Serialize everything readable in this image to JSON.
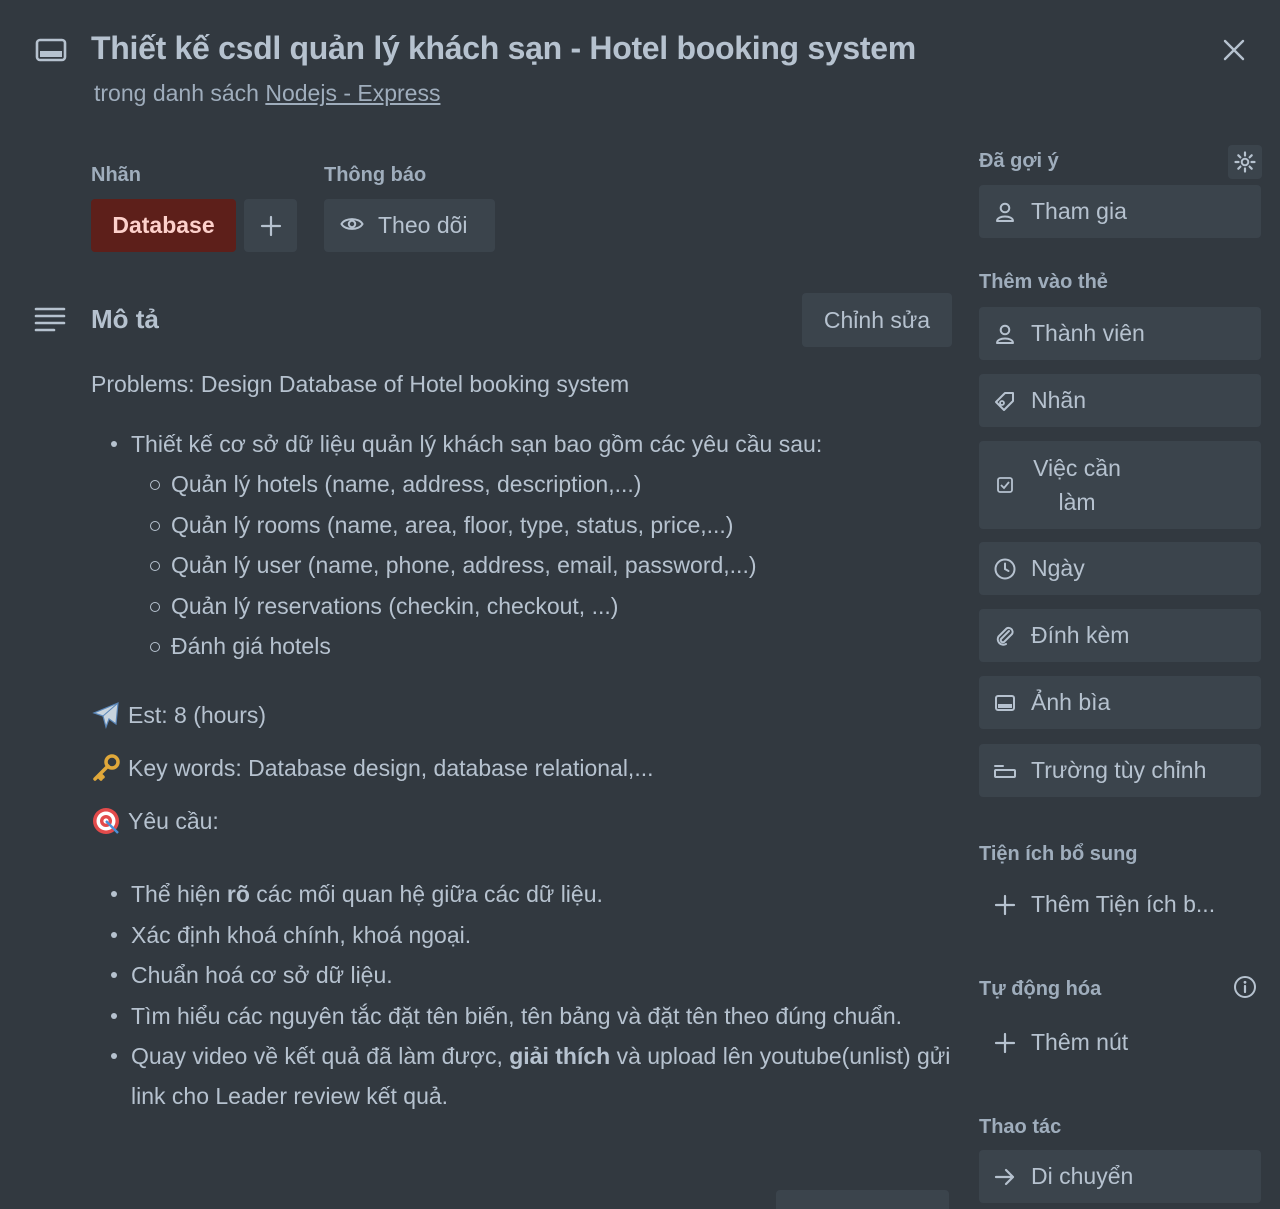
{
  "header": {
    "title": "Thiết kế csdl quản lý khách sạn - Hotel booking system",
    "list_prefix": "trong danh sách",
    "list_name": "Nodejs - Express"
  },
  "labels_section": {
    "heading": "Nhãn",
    "chip": "Database",
    "chip_color": "#5d1f1a"
  },
  "notify_section": {
    "heading": "Thông báo",
    "watch_label": "Theo dõi"
  },
  "description": {
    "heading": "Mô tả",
    "edit_label": "Chỉnh sửa",
    "problem": "Problems: Design Database of Hotel booking system",
    "main_item": "Thiết kế cơ sở dữ liệu quản lý khách sạn bao gồm các yêu cầu sau:",
    "sub_items": [
      "Quản lý hotels (name, address, description,...)",
      "Quản lý rooms (name, area, floor, type, status, price,...)",
      "Quản lý user (name, phone, address, email, password,...)",
      "Quản lý reservations (checkin, checkout, ...)",
      "Đánh giá hotels"
    ],
    "est": "Est: 8 (hours)",
    "keywords": "Key words: Database design, database relational,...",
    "requirements_heading": "Yêu cầu:",
    "req1": {
      "a": "Thể hiện ",
      "b": "rõ",
      "c": " các mối quan hệ giữa các dữ liệu."
    },
    "req2": "Xác định khoá chính, khoá ngoại.",
    "req3": "Chuẩn hoá cơ sở dữ liệu.",
    "req4": "Tìm hiểu các nguyên tắc đặt tên biến, tên bảng và đặt tên theo đúng chuẩn.",
    "req5": {
      "a": "Quay video về kết quả đã làm được, ",
      "b": "giải thích",
      "c": " và upload lên youtube(unlist) gửi link cho Leader review kết quả."
    }
  },
  "sidebar": {
    "suggested_heading": "Đã gợi ý",
    "join": "Tham gia",
    "add_to_card_heading": "Thêm vào thẻ",
    "members": "Thành viên",
    "labels": "Nhãn",
    "checklist": "Việc cần làm",
    "dates": "Ngày",
    "attachment": "Đính kèm",
    "cover": "Ảnh bìa",
    "custom_fields": "Trường tùy chỉnh",
    "powerups_heading": "Tiện ích bổ sung",
    "add_powerup": "Thêm Tiện ích b...",
    "automation_heading": "Tự động hóa",
    "add_button": "Thêm nút",
    "actions_heading": "Thao tác",
    "move": "Di chuyển"
  }
}
